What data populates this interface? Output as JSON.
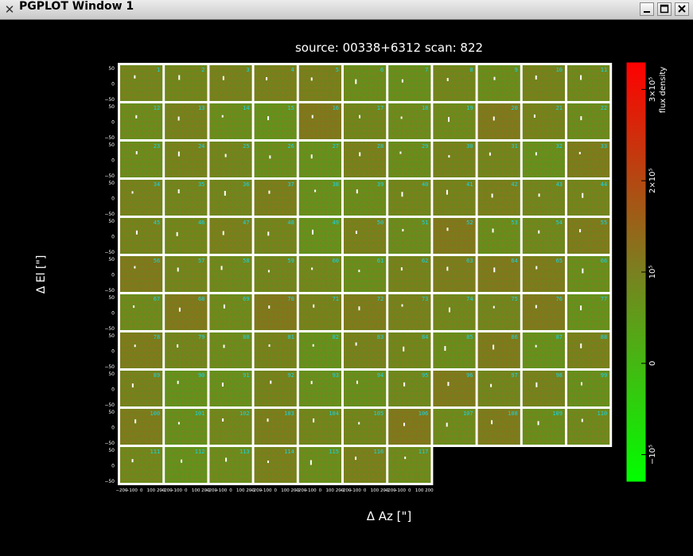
{
  "window": {
    "title": "PGPLOT Window 1",
    "buttons": [
      "minimize",
      "maximize",
      "close"
    ]
  },
  "plot": {
    "title": "source: 00338+6312   scan: 822",
    "xlabel": "Δ Az  [\"]",
    "ylabel": "Δ El  [\"]",
    "colorbar_label": "flux density",
    "colorbar_ticks": [
      {
        "value": -100000,
        "label": "−10⁵"
      },
      {
        "value": 0,
        "label": "0"
      },
      {
        "value": 100000,
        "label": "10⁵"
      },
      {
        "value": 200000,
        "label": "2×10⁵"
      },
      {
        "value": 300000,
        "label": "3×10⁵"
      }
    ],
    "colorbar_range": [
      -130000,
      330000
    ],
    "colors": {
      "background": "#000000",
      "frame": "#ffffff",
      "map_base": "#5a9a1e",
      "map_red": "#b8441a",
      "number_label": "#19d6e6",
      "cmap_low": "#00ff00",
      "cmap_mid": "#7a8020",
      "cmap_high": "#ff0000"
    }
  },
  "chart_data": {
    "type": "heatmap",
    "layout": {
      "rows": 11,
      "columns": 11,
      "panel_count": 117
    },
    "panel_x_ticks": [
      "−200",
      "−100",
      "0",
      "100",
      "200"
    ],
    "panel_y_ticks": [
      "50",
      "0",
      "−50"
    ],
    "xlim": [
      -200,
      200
    ],
    "ylim": [
      -60,
      60
    ],
    "panel_labels": [
      "1",
      "2",
      "3",
      "4",
      "5",
      "6",
      "7",
      "8",
      "9",
      "10",
      "11",
      "12",
      "13",
      "14",
      "15",
      "16",
      "17",
      "18",
      "19",
      "20",
      "21",
      "22",
      "23",
      "24",
      "25",
      "26",
      "27",
      "28",
      "29",
      "30",
      "31",
      "32",
      "33",
      "34",
      "35",
      "36",
      "37",
      "38",
      "39",
      "40",
      "41",
      "42",
      "43",
      "44",
      "45",
      "46",
      "47",
      "48",
      "49",
      "50",
      "51",
      "52",
      "53",
      "54",
      "55",
      "56",
      "57",
      "58",
      "59",
      "60",
      "61",
      "62",
      "63",
      "64",
      "65",
      "66",
      "67",
      "68",
      "69",
      "70",
      "71",
      "72",
      "73",
      "74",
      "75",
      "76",
      "77",
      "78",
      "79",
      "80",
      "81",
      "82",
      "83",
      "84",
      "85",
      "86",
      "87",
      "88",
      "89",
      "90",
      "91",
      "92",
      "93",
      "94",
      "95",
      "96",
      "97",
      "98",
      "99",
      "100",
      "101",
      "102",
      "103",
      "104",
      "105",
      "106",
      "107",
      "108",
      "109",
      "110",
      "111",
      "112",
      "113",
      "114",
      "115",
      "116",
      "117"
    ]
  }
}
